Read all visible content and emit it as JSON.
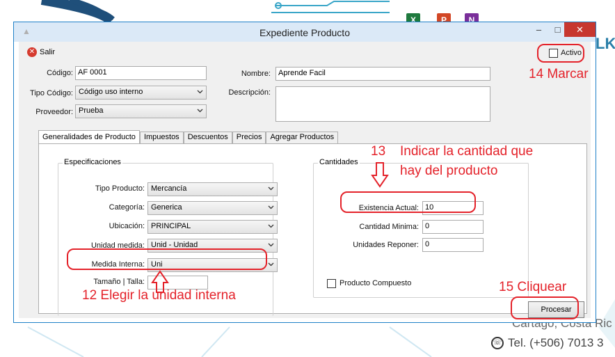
{
  "window": {
    "title": "Expediente Producto",
    "minimize": "–",
    "maximize": "□",
    "close": "✕"
  },
  "toolbar": {
    "exit_label": "Salir"
  },
  "header": {
    "active_label": "Activo",
    "code_label": "Código:",
    "code_value": "AF 0001",
    "code_type_label": "Tipo Código:",
    "code_type_value": "Código uso interno",
    "supplier_label": "Proveedor:",
    "supplier_value": "Prueba",
    "name_label": "Nombre:",
    "name_value": "Aprende Facil",
    "description_label": "Descripción:",
    "description_value": ""
  },
  "tabs": [
    {
      "label": "Generalidades de Producto",
      "active": true
    },
    {
      "label": "Impuestos",
      "active": false
    },
    {
      "label": "Descuentos",
      "active": false
    },
    {
      "label": "Precios",
      "active": false
    },
    {
      "label": "Agregar Productos",
      "active": false
    }
  ],
  "specs": {
    "group_title": "Especificaciones",
    "product_type_label": "Tipo Producto:",
    "product_type_value": "Mercancía",
    "category_label": "Categoría:",
    "category_value": "Generica",
    "location_label": "Ubicación:",
    "location_value": "PRINCIPAL",
    "unit_label": "Unidad medida:",
    "unit_value": "Unid - Unidad",
    "internal_measure_label": "Medida Interna:",
    "internal_measure_value": "Uni",
    "size_label": "Tamaño | Talla:",
    "size_value": ""
  },
  "quantities": {
    "group_title": "Cantidades",
    "current_stock_label": "Existencia Actual:",
    "current_stock_value": "10",
    "min_qty_label": "Cantidad Minima:",
    "min_qty_value": "0",
    "reorder_label": "Unidades Reponer:",
    "reorder_value": "0",
    "composite_label": "Producto Compuesto"
  },
  "actions": {
    "process_label": "Procesar"
  },
  "annotations": {
    "a12": "12 Elegir la unidad interna",
    "a13_num": "13",
    "a13_line1": "Indicar la cantidad que",
    "a13_line2": "hay del producto",
    "a14": "14 Marcar",
    "a15": "15 Cliquear"
  },
  "background": {
    "logo_fragment": "LK",
    "address_fragment": "Cartago, Costa Ric",
    "phone": "Tel. (+506) 7013 3"
  },
  "colors": {
    "annotation": "#e4222a",
    "titlebar": "#dbe9f7",
    "close": "#c7372f",
    "accent": "#1e80c8"
  }
}
